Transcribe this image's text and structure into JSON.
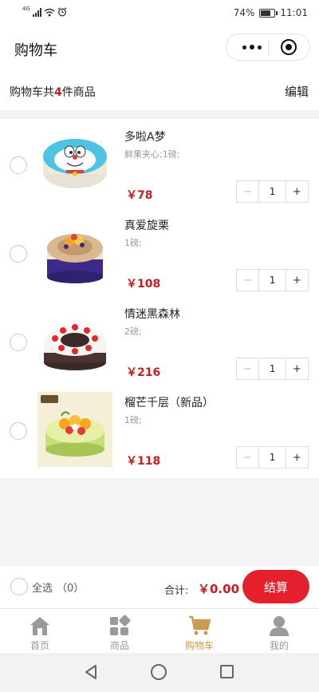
{
  "status_bar": {
    "network": "4G",
    "battery": "74%",
    "time": "11:01"
  },
  "header": {
    "title": "购物车"
  },
  "summary": {
    "prefix": "购物车共",
    "count": "4",
    "suffix": "件商品",
    "edit_label": "编辑"
  },
  "cart": {
    "items": [
      {
        "name": "多啦A梦",
        "spec": "鲜果夹心;1磅;",
        "price": "￥78",
        "quantity": "1",
        "image": "doraemon-cake"
      },
      {
        "name": "真爱旋栗",
        "spec": "1磅;",
        "price": "￥108",
        "quantity": "1",
        "image": "chestnut-fruit-cake"
      },
      {
        "name": "情迷黑森林",
        "spec": "2磅;",
        "price": "￥216",
        "quantity": "1",
        "image": "black-forest-cake"
      },
      {
        "name": "榴芒千层（新品）",
        "spec": "1磅;",
        "price": "￥118",
        "quantity": "1",
        "image": "durian-mango-cake"
      }
    ],
    "minus_label": "−",
    "plus_label": "+"
  },
  "checkout": {
    "select_all_label": "全选",
    "selected_count": "（0）",
    "total_label": "合计:",
    "total_value": "￥0.00",
    "button_label": "结算"
  },
  "tabbar": {
    "items": [
      {
        "label": "首页",
        "icon": "home-icon",
        "active": false
      },
      {
        "label": "商品",
        "icon": "category-icon",
        "active": false
      },
      {
        "label": "购物车",
        "icon": "cart-icon",
        "active": true
      },
      {
        "label": "我的",
        "icon": "user-icon",
        "active": false
      }
    ]
  },
  "colors": {
    "accent": "#c71c22",
    "button": "#e3202b",
    "tab_active": "#c89a52",
    "tab_inactive": "#999999"
  }
}
